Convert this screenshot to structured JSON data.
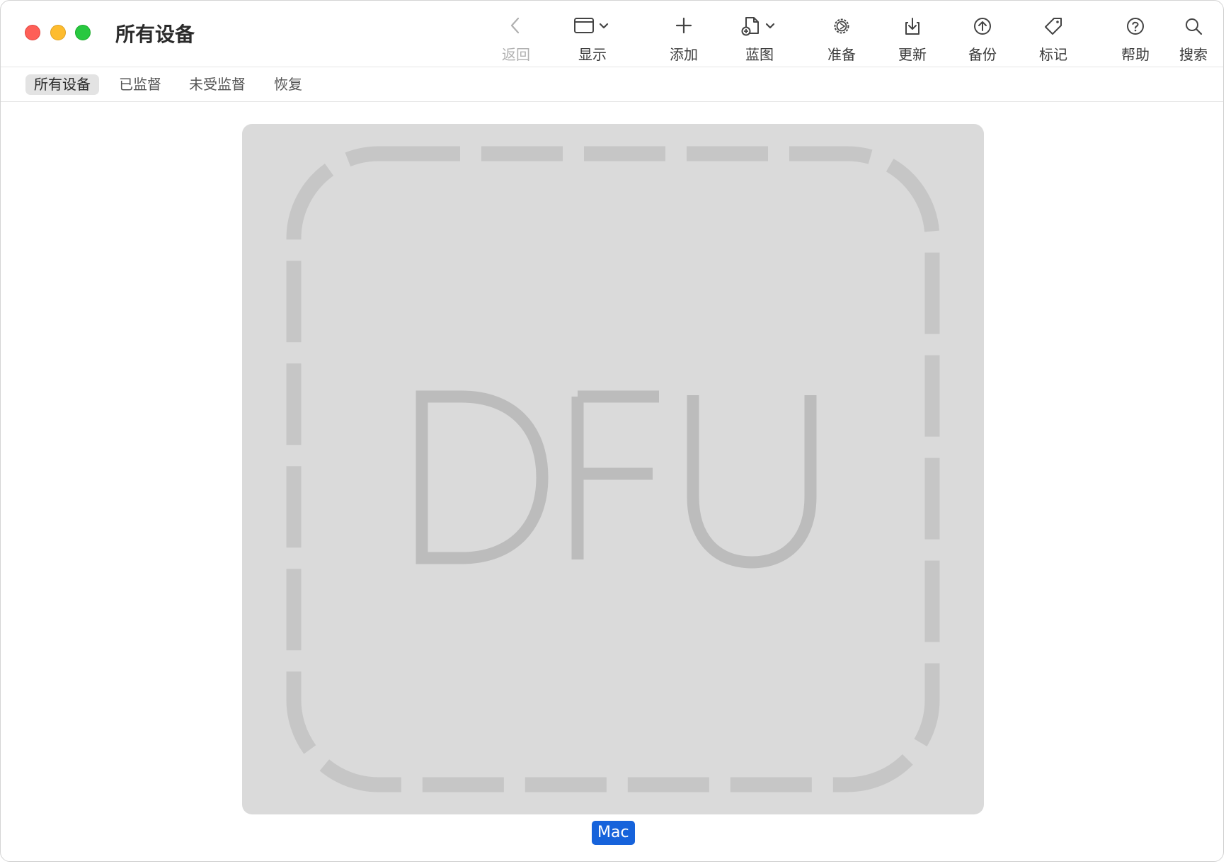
{
  "window": {
    "title": "所有设备"
  },
  "toolbar": {
    "back_label": "返回",
    "view_label": "显示",
    "add_label": "添加",
    "blueprint_label": "蓝图",
    "prepare_label": "准备",
    "update_label": "更新",
    "backup_label": "备份",
    "tag_label": "标记",
    "help_label": "帮助",
    "search_label": "搜索"
  },
  "filters": {
    "items": [
      "所有设备",
      "已监督",
      "未受监督",
      "恢复"
    ],
    "selected": "所有设备"
  },
  "device": {
    "mode_text": "DFU",
    "name": "Mac"
  },
  "colors": {
    "selection": "#1663db",
    "tile_background": "#dadada",
    "tile_art": "#bcbcbc"
  }
}
